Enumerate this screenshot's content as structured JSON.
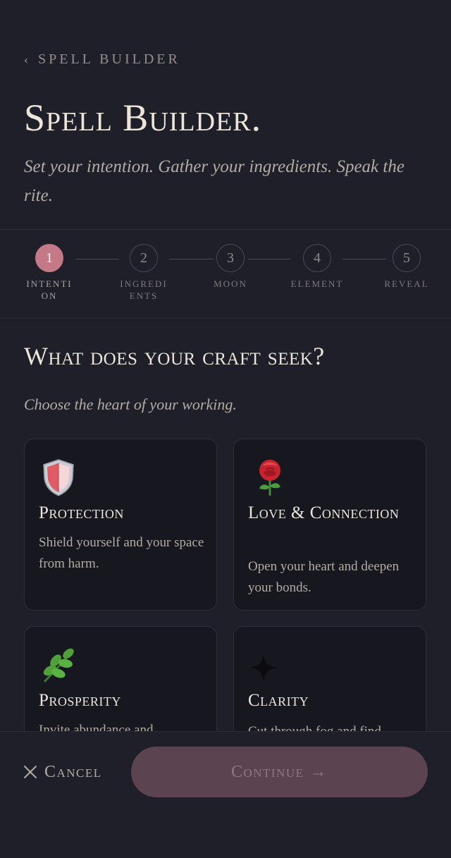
{
  "header": {
    "back_label": "SPELL BUILDER",
    "title": "Spell Builder.",
    "subtitle": "Set your intention. Gather your ingredients. Speak the rite."
  },
  "stepper": {
    "steps": [
      {
        "number": "1",
        "label": "INTENTI ON",
        "active": true
      },
      {
        "number": "2",
        "label": "INGREDI ENTS",
        "active": false
      },
      {
        "number": "3",
        "label": "MOON",
        "active": false
      },
      {
        "number": "4",
        "label": "ELEMENT",
        "active": false
      },
      {
        "number": "5",
        "label": "REVEAL",
        "active": false
      }
    ]
  },
  "section": {
    "heading": "What does your craft seek?",
    "subheading": "Choose the heart of your working."
  },
  "cards": [
    {
      "icon": "shield-icon",
      "title": "Protection",
      "description": "Shield yourself and your space from harm."
    },
    {
      "icon": "rose-icon",
      "title": "Love & Connection",
      "description": "Open your heart and deepen your bonds."
    },
    {
      "icon": "herb-icon",
      "title": "Prosperity",
      "description": "Invite abundance and"
    },
    {
      "icon": "sparkle-icon",
      "title": "Clarity",
      "description": "Cut through fog and find"
    }
  ],
  "footer": {
    "cancel_label": "Cancel",
    "continue_label": "Continue",
    "continue_arrow": "→"
  },
  "colors": {
    "background": "#1e1f29",
    "card_background": "#16171f",
    "accent": "#c47a86",
    "continue_button": "#5b4350"
  }
}
